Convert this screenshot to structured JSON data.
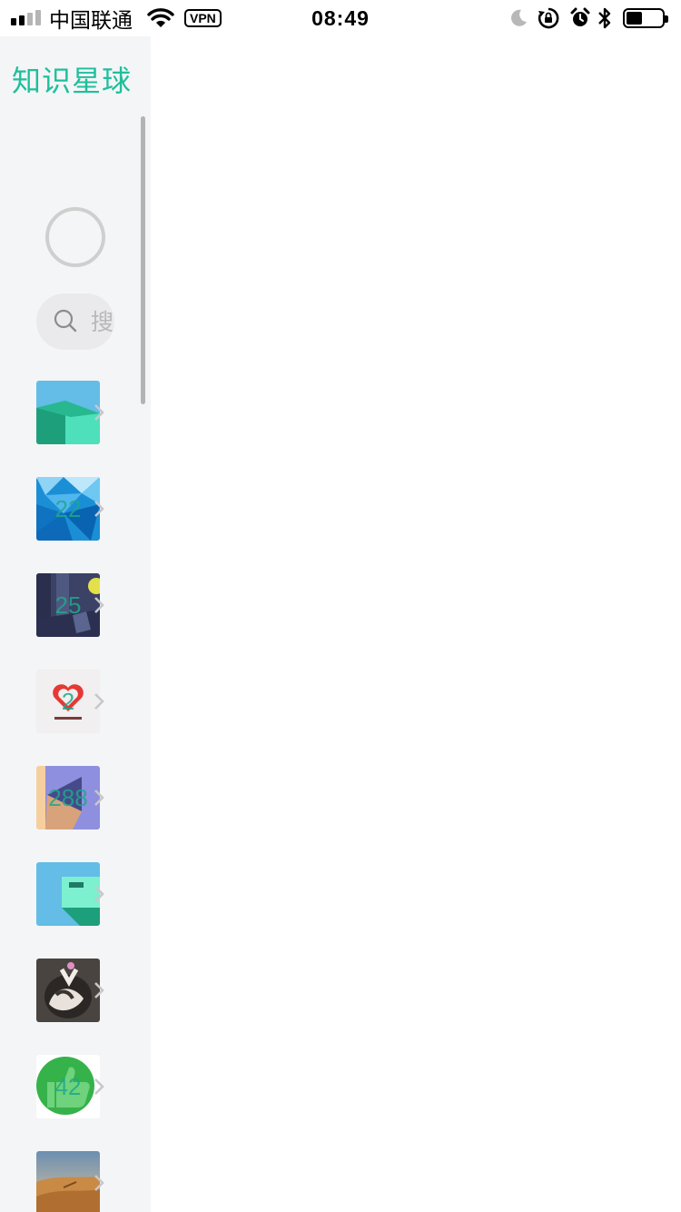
{
  "status_bar": {
    "carrier": "中国联通",
    "vpn": "VPN",
    "time": "08:49",
    "battery_level": 0.45
  },
  "sidebar": {
    "title": "知识星球",
    "search_placeholder": "搜索星球",
    "groups": [
      {
        "icon": "green-building-thumbnail",
        "count": ""
      },
      {
        "icon": "blue-polygon-thumbnail",
        "count": "22"
      },
      {
        "icon": "night-room-thumbnail",
        "count": "25"
      },
      {
        "icon": "heart-charity-thumbnail",
        "count": "2"
      },
      {
        "icon": "paper-plane-thumbnail",
        "count": "288"
      },
      {
        "icon": "green-folder-thumbnail",
        "count": ""
      },
      {
        "icon": "cat-photo-thumbnail",
        "count": ""
      },
      {
        "icon": "thumbs-up-thumbnail",
        "count": "42"
      },
      {
        "icon": "desert-photo-thumbnail",
        "count": ""
      }
    ]
  },
  "colors": {
    "accent": "#1fbf9b",
    "sidebar_bg": "#f4f5f7"
  }
}
